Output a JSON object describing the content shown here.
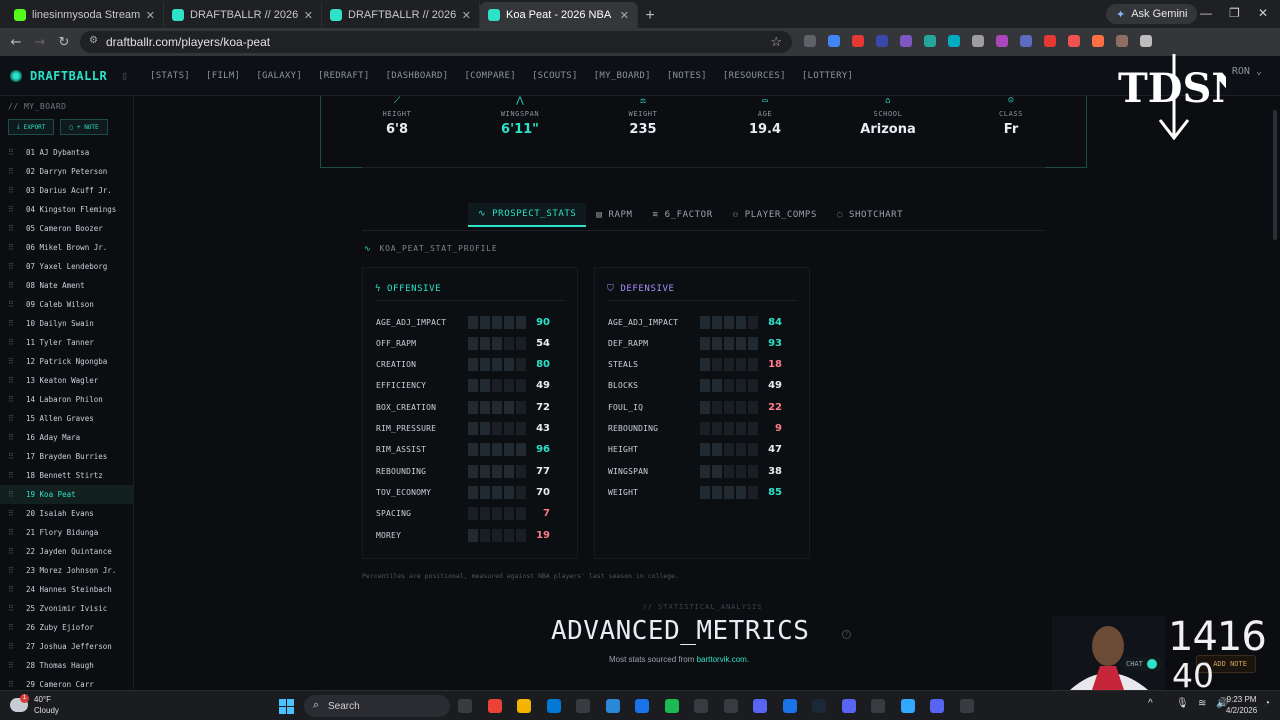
{
  "browser": {
    "tabs": [
      {
        "title": "linesinmysoda Stream - Kick Da",
        "fav_color": "#53fc18",
        "active": false
      },
      {
        "title": "DRAFTBALLR // 2026 NBA Draf",
        "fav_color": "#2de2c8",
        "active": false
      },
      {
        "title": "DRAFTBALLR // 2026 NBA Draf",
        "fav_color": "#2de2c8",
        "active": false
      },
      {
        "title": "Koa Peat - 2026 NBA Draft Prof",
        "fav_color": "#2de2c8",
        "active": true
      }
    ],
    "new_tab": "+",
    "ask_gemini": "Ask Gemini",
    "url": "draftballr.com/players/koa-peat"
  },
  "app": {
    "brand": "DRAFTBALLR",
    "nav": [
      "[STATS]",
      "[FILM]",
      "[GALAXY]",
      "[REDRAFT]",
      "[DASHBOARD]",
      "[COMPARE]",
      "[SCOUTS]",
      "[MY_BOARD]",
      "[NOTES]",
      "[RESOURCES]",
      "[LOTTERY]"
    ],
    "user": "RON"
  },
  "sidebar": {
    "title": "// MY_BOARD",
    "export_label": "EXPORT",
    "note_label": "+ NOTE",
    "items": [
      "01 AJ Dybantsa",
      "02 Darryn Peterson",
      "03 Darius Acuff Jr.",
      "04 Kingston Flemings",
      "05 Cameron Boozer",
      "06 Mikel Brown Jr.",
      "07 Yaxel Lendeborg",
      "08 Nate Ament",
      "09 Caleb Wilson",
      "10 Dailyn Swain",
      "11 Tyler Tanner",
      "12 Patrick Ngongba",
      "13 Keaton Wagler",
      "14 Labaron Philon",
      "15 Allen Graves",
      "16 Aday Mara",
      "17 Brayden Burries",
      "18 Bennett Stirtz",
      "19 Koa Peat",
      "20 Isaiah Evans",
      "21 Flory Bidunga",
      "22 Jayden Quintance",
      "23 Morez Johnson Jr.",
      "24 Hannes Steinbach",
      "25 Zvonimir Ivisic",
      "26 Zuby Ejiofor",
      "27 Joshua Jefferson",
      "28 Thomas Haugh",
      "29 Cameron Carr"
    ],
    "active_index": 18
  },
  "bio": [
    {
      "label": "HEIGHT",
      "value": "6'8",
      "accent": false,
      "icon": "ruler-icon"
    },
    {
      "label": "WINGSPAN",
      "value": "6'11\"",
      "accent": true,
      "icon": "wingspan-icon"
    },
    {
      "label": "WEIGHT",
      "value": "235",
      "accent": false,
      "icon": "scale-icon"
    },
    {
      "label": "AGE",
      "value": "19.4",
      "accent": false,
      "icon": "calendar-icon"
    },
    {
      "label": "SCHOOL",
      "value": "Arizona",
      "accent": false,
      "icon": "school-icon"
    },
    {
      "label": "CLASS",
      "value": "Fr",
      "accent": false,
      "icon": "person-icon"
    }
  ],
  "tabs": [
    "PROSPECT_STATS",
    "RAPM",
    "6_FACTOR",
    "PLAYER_COMPS",
    "SHOTCHART"
  ],
  "active_tab": 0,
  "profile_title": "KOA_PEAT_STAT_PROFILE",
  "offensive": {
    "title": "OFFENSIVE",
    "color": "#2de2c8",
    "rows": [
      {
        "label": "AGE_ADJ_IMPACT",
        "value": "90"
      },
      {
        "label": "OFF_RAPM",
        "value": "54"
      },
      {
        "label": "CREATION",
        "value": "80"
      },
      {
        "label": "EFFICIENCY",
        "value": "49"
      },
      {
        "label": "BOX_CREATION",
        "value": "72"
      },
      {
        "label": "RIM_PRESSURE",
        "value": "43"
      },
      {
        "label": "RIM_ASSIST",
        "value": "96"
      },
      {
        "label": "REBOUNDING",
        "value": "77"
      },
      {
        "label": "TOV_ECONOMY",
        "value": "70"
      },
      {
        "label": "SPACING",
        "value": "7"
      },
      {
        "label": "MOREY",
        "value": "19"
      }
    ]
  },
  "defensive": {
    "title": "DEFENSIVE",
    "color": "#a78bfa",
    "rows": [
      {
        "label": "AGE_ADJ_IMPACT",
        "value": "84"
      },
      {
        "label": "DEF_RAPM",
        "value": "93"
      },
      {
        "label": "STEALS",
        "value": "18"
      },
      {
        "label": "BLOCKS",
        "value": "49"
      },
      {
        "label": "FOUL_IQ",
        "value": "22"
      },
      {
        "label": "REBOUNDING",
        "value": "9"
      },
      {
        "label": "HEIGHT",
        "value": "47"
      },
      {
        "label": "WINGSPAN",
        "value": "38"
      },
      {
        "label": "WEIGHT",
        "value": "85"
      }
    ]
  },
  "value_colors": {
    "high": "#2de2c8",
    "mid": "#e6edf3",
    "low": "#ff7a8a"
  },
  "footnote": "Percentiles are positional, measured against NBA players' last season in college.",
  "analysis": {
    "kicker": "// STATISTICAL_ANALYSIS",
    "title": "ADVANCED_METRICS",
    "sub_prefix": "Most stats sourced from ",
    "sub_link": "barttorvik.com",
    "sub_suffix": "."
  },
  "overlay": {
    "viewer_count_1": "1416",
    "viewer_count_2": "40",
    "chat": "CHAT",
    "add_note": "ADD NOTE"
  },
  "taskbar": {
    "temp": "40°F",
    "condition": "Cloudy",
    "badge": "1",
    "search": "Search",
    "time": "9:23 PM",
    "date": "4/2/2026"
  }
}
